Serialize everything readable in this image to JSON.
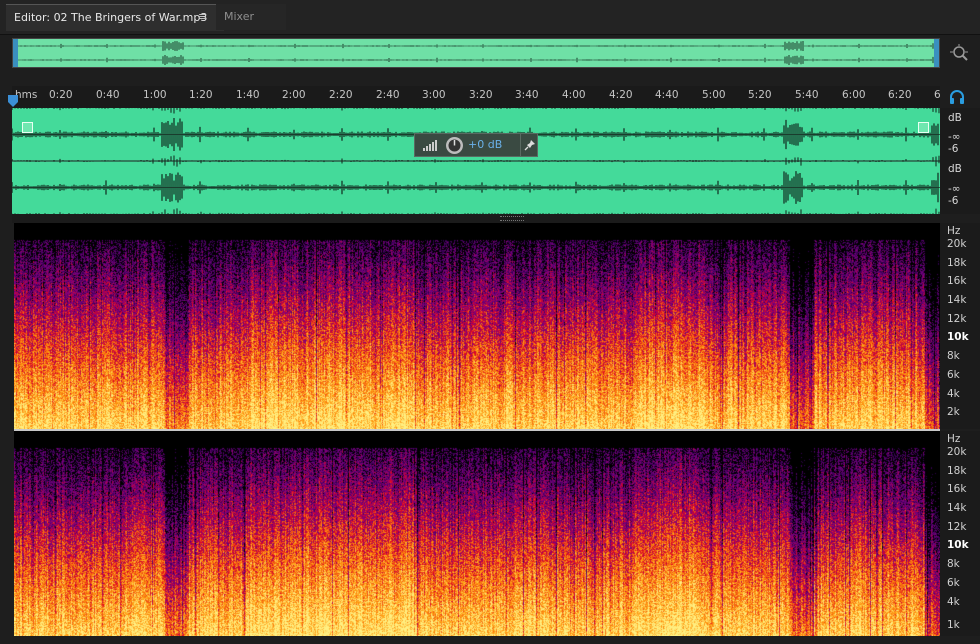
{
  "tabs": {
    "editor_label": "Editor: 02 The Bringers of War.mp3",
    "editor_menu_glyph": "≡",
    "mixer_label": "Mixer"
  },
  "toolbar": {
    "zoom_icon": "magnifier-zoom-icon",
    "headphones_icon": "headphones-icon"
  },
  "ruler": {
    "unit_label": "hms",
    "ticks": [
      "0:20",
      "0:40",
      "1:00",
      "1:20",
      "1:40",
      "2:00",
      "2:20",
      "2:40",
      "3:00",
      "3:20",
      "3:40",
      "4:00",
      "4:20",
      "4:40",
      "5:00",
      "5:20",
      "5:40",
      "6:00",
      "6:20",
      "6"
    ]
  },
  "waveform": {
    "color": "#44da9a",
    "hud_gain": "+0 dB",
    "db_labels_top": [
      "dB",
      "-∞",
      "-6"
    ],
    "db_labels_bottom": [
      "dB",
      "-∞",
      "-6"
    ]
  },
  "spectral": {
    "unit_label": "Hz",
    "freq_labels": [
      "20k",
      "18k",
      "16k",
      "14k",
      "12k",
      "10k",
      "8k",
      "6k",
      "4k",
      "2k",
      "1k"
    ],
    "bold_label": "10k"
  }
}
